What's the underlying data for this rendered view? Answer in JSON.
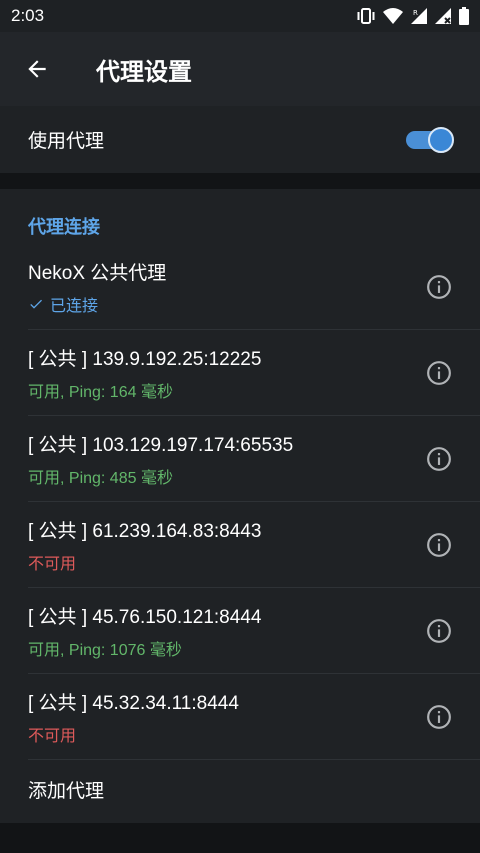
{
  "status_bar": {
    "time": "2:03",
    "icons": [
      "vibrate-icon",
      "wifi-icon",
      "signal-r-icon",
      "signal-icon",
      "battery-icon"
    ]
  },
  "appbar": {
    "title": "代理设置",
    "back_icon": "arrow-left-icon"
  },
  "use_proxy": {
    "label": "使用代理",
    "enabled": true
  },
  "proxy_section": {
    "header": "代理连接",
    "items": [
      {
        "title": "NekoX 公共代理",
        "status": "已连接",
        "status_type": "connected"
      },
      {
        "title": "[ 公共 ] 139.9.192.25:12225",
        "status": "可用, Ping: 164 毫秒",
        "status_type": "ok"
      },
      {
        "title": "[ 公共 ] 103.129.197.174:65535",
        "status": "可用, Ping: 485 毫秒",
        "status_type": "ok"
      },
      {
        "title": "[ 公共 ] 61.239.164.83:8443",
        "status": "不可用",
        "status_type": "bad"
      },
      {
        "title": "[ 公共 ] 45.76.150.121:8444",
        "status": "可用, Ping: 1076 毫秒",
        "status_type": "ok"
      },
      {
        "title": "[ 公共 ] 45.32.34.11:8444",
        "status": "不可用",
        "status_type": "bad"
      }
    ],
    "add_label": "添加代理"
  },
  "colors": {
    "accent": "#5ea5e8",
    "ok": "#62b66a",
    "bad": "#de5a5a",
    "toggle": "#3a87d6"
  }
}
